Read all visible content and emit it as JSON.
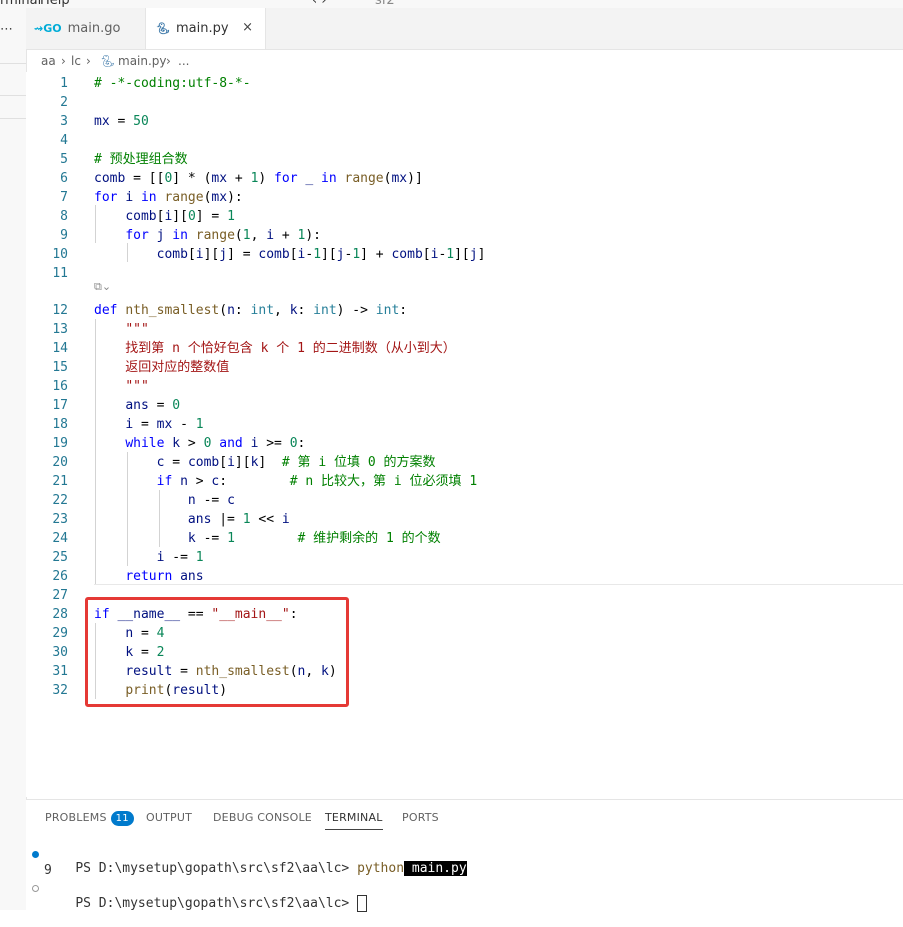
{
  "menubar": {
    "item1": "rminal",
    "item2": "Help",
    "search": "sf2",
    "arrows": "‹  ›"
  },
  "tabs": [
    {
      "label": "main.go",
      "icon": "go-icon"
    },
    {
      "label": "main.py",
      "icon": "python-icon",
      "close": "×"
    }
  ],
  "breadcrumb": {
    "p1": "aa",
    "p2": "lc",
    "p3": "main.py",
    "p4": "..."
  },
  "codelens": "⧉⌄",
  "code": [
    {
      "n": "1",
      "html": "<span class='c'># -*-coding:utf-8-*-</span>"
    },
    {
      "n": "2",
      "html": ""
    },
    {
      "n": "3",
      "html": "<span class='v'>mx</span> = <span class='n'>50</span>"
    },
    {
      "n": "4",
      "html": ""
    },
    {
      "n": "5",
      "html": "<span class='c'># 预处理组合数</span>"
    },
    {
      "n": "6",
      "html": "<span class='v'>comb</span> = [[<span class='n'>0</span>] * (<span class='v'>mx</span> + <span class='n'>1</span>) <span class='k'>for</span> <span class='v'>_</span> <span class='k'>in</span> <span class='f'>range</span>(<span class='v'>mx</span>)]"
    },
    {
      "n": "7",
      "html": "<span class='k'>for</span> <span class='v'>i</span> <span class='k'>in</span> <span class='f'>range</span>(<span class='v'>mx</span>):"
    },
    {
      "n": "8",
      "html": "    <span class='v'>comb</span>[<span class='v'>i</span>][<span class='n'>0</span>] = <span class='n'>1</span>"
    },
    {
      "n": "9",
      "html": "    <span class='k'>for</span> <span class='v'>j</span> <span class='k'>in</span> <span class='f'>range</span>(<span class='n'>1</span>, <span class='v'>i</span> + <span class='n'>1</span>):"
    },
    {
      "n": "10",
      "html": "        <span class='v'>comb</span>[<span class='v'>i</span>][<span class='v'>j</span>] = <span class='v'>comb</span>[<span class='v'>i</span>-<span class='n'>1</span>][<span class='v'>j</span>-<span class='n'>1</span>] + <span class='v'>comb</span>[<span class='v'>i</span>-<span class='n'>1</span>][<span class='v'>j</span>]"
    },
    {
      "n": "11",
      "html": ""
    },
    {
      "n": "12",
      "html": "<span class='k'>def</span> <span class='f'>nth_smallest</span>(<span class='v'>n</span>: <span class='ty'>int</span>, <span class='v'>k</span>: <span class='ty'>int</span>) -&gt; <span class='ty'>int</span>:"
    },
    {
      "n": "13",
      "html": "    <span class='s'>\"\"\"</span>"
    },
    {
      "n": "14",
      "html": "<span class='s'>    找到第 n 个恰好包含 k 个 1 的二进制数（从小到大）</span>"
    },
    {
      "n": "15",
      "html": "<span class='s'>    返回对应的整数值</span>"
    },
    {
      "n": "16",
      "html": "    <span class='s'>\"\"\"</span>"
    },
    {
      "n": "17",
      "html": "    <span class='v'>ans</span> = <span class='n'>0</span>"
    },
    {
      "n": "18",
      "html": "    <span class='v'>i</span> = <span class='v'>mx</span> - <span class='n'>1</span>"
    },
    {
      "n": "19",
      "html": "    <span class='k'>while</span> <span class='v'>k</span> &gt; <span class='n'>0</span> <span class='k'>and</span> <span class='v'>i</span> &gt;= <span class='n'>0</span>:"
    },
    {
      "n": "20",
      "html": "        <span class='v'>c</span> = <span class='v'>comb</span>[<span class='v'>i</span>][<span class='v'>k</span>]  <span class='c'># 第 i 位填 0 的方案数</span>"
    },
    {
      "n": "21",
      "html": "        <span class='k'>if</span> <span class='v'>n</span> &gt; <span class='v'>c</span>:        <span class='c'># n 比较大，第 i 位必须填 1</span>"
    },
    {
      "n": "22",
      "html": "            <span class='v'>n</span> -= <span class='v'>c</span>"
    },
    {
      "n": "23",
      "html": "            <span class='v'>ans</span> |= <span class='n'>1</span> &lt;&lt; <span class='v'>i</span>"
    },
    {
      "n": "24",
      "html": "            <span class='v'>k</span> -= <span class='n'>1</span>        <span class='c'># 维护剩余的 1 的个数</span>"
    },
    {
      "n": "25",
      "html": "        <span class='v'>i</span> -= <span class='n'>1</span>"
    },
    {
      "n": "26",
      "html": "    <span class='k'>return</span> <span class='v'>ans</span>"
    },
    {
      "n": "27",
      "html": ""
    },
    {
      "n": "28",
      "html": "<span class='k'>if</span> <span class='v'>__name__</span> == <span class='s'>\"__main__\"</span>:"
    },
    {
      "n": "29",
      "html": "    <span class='v'>n</span> = <span class='n'>4</span>"
    },
    {
      "n": "30",
      "html": "    <span class='v'>k</span> = <span class='n'>2</span>"
    },
    {
      "n": "31",
      "html": "    <span class='v'>result</span> = <span class='f'>nth_smallest</span>(<span class='v'>n</span>, <span class='v'>k</span>)"
    },
    {
      "n": "32",
      "html": "    <span class='f'>print</span>(<span class='v'>result</span>)"
    }
  ],
  "panel": {
    "tabs": [
      "PROBLEMS",
      "OUTPUT",
      "DEBUG CONSOLE",
      "TERMINAL",
      "PORTS"
    ],
    "problems_count": "11",
    "terminal": {
      "prompt1": "PS D:\\mysetup\\gopath\\src\\sf2\\aa\\lc>",
      "cmd": "python",
      "arg": "main.py",
      "output": "9",
      "prompt2": "PS D:\\mysetup\\gopath\\src\\sf2\\aa\\lc>"
    }
  },
  "colors": {
    "accent": "#007acc",
    "highlight": "#e53935"
  }
}
